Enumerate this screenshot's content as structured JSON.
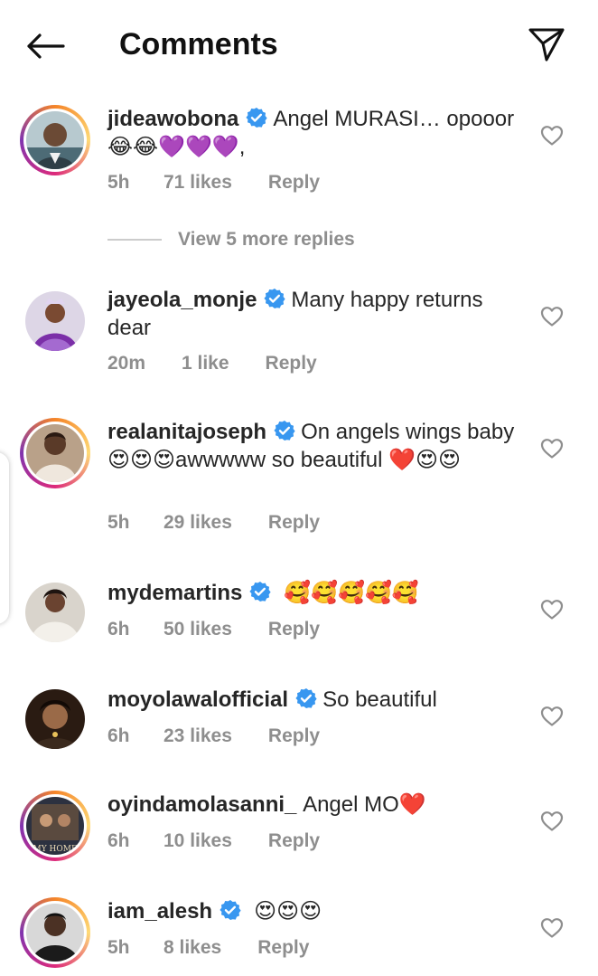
{
  "header": {
    "title": "Comments",
    "back_icon": "arrow-left-icon",
    "share_icon": "paper-plane-icon"
  },
  "colors": {
    "text": "#262626",
    "muted": "#8e8e8e",
    "verified": "#3897f0",
    "heart_outline": "#8e8e8e"
  },
  "comments": [
    {
      "username": "jideawobona",
      "verified": true,
      "text": "Angel MURASI… opooor😂😂💜💜💜,",
      "time": "5h",
      "likes": "71 likes",
      "reply": "Reply",
      "story_ring": true
    },
    {
      "username": "jayeola_monje",
      "verified": true,
      "text": "Many happy returns dear",
      "time": "20m",
      "likes": "1 like",
      "reply": "Reply",
      "story_ring": false
    },
    {
      "username": "realanitajoseph",
      "verified": true,
      "text": "On angels wings baby 😍😍😍awwwww so beautiful ❤️😍😍",
      "time": "5h",
      "likes": "29 likes",
      "reply": "Reply",
      "story_ring": true
    },
    {
      "username": "mydemartins",
      "verified": true,
      "text": "🥰🥰🥰🥰🥰",
      "time": "6h",
      "likes": "50 likes",
      "reply": "Reply",
      "story_ring": false
    },
    {
      "username": "moyolawalofficial",
      "verified": true,
      "text": "So beautiful",
      "time": "6h",
      "likes": "23 likes",
      "reply": "Reply",
      "story_ring": false
    },
    {
      "username": "oyindamolasanni_",
      "verified": false,
      "text": "Angel MO❤️",
      "time": "6h",
      "likes": "10 likes",
      "reply": "Reply",
      "story_ring": true
    },
    {
      "username": "iam_alesh",
      "verified": true,
      "text": "😍😍😍",
      "time": "5h",
      "likes": "8 likes",
      "reply": "Reply",
      "story_ring": true
    }
  ],
  "view_replies": "View 5 more replies",
  "avatar_logo_text": "MY HOME"
}
